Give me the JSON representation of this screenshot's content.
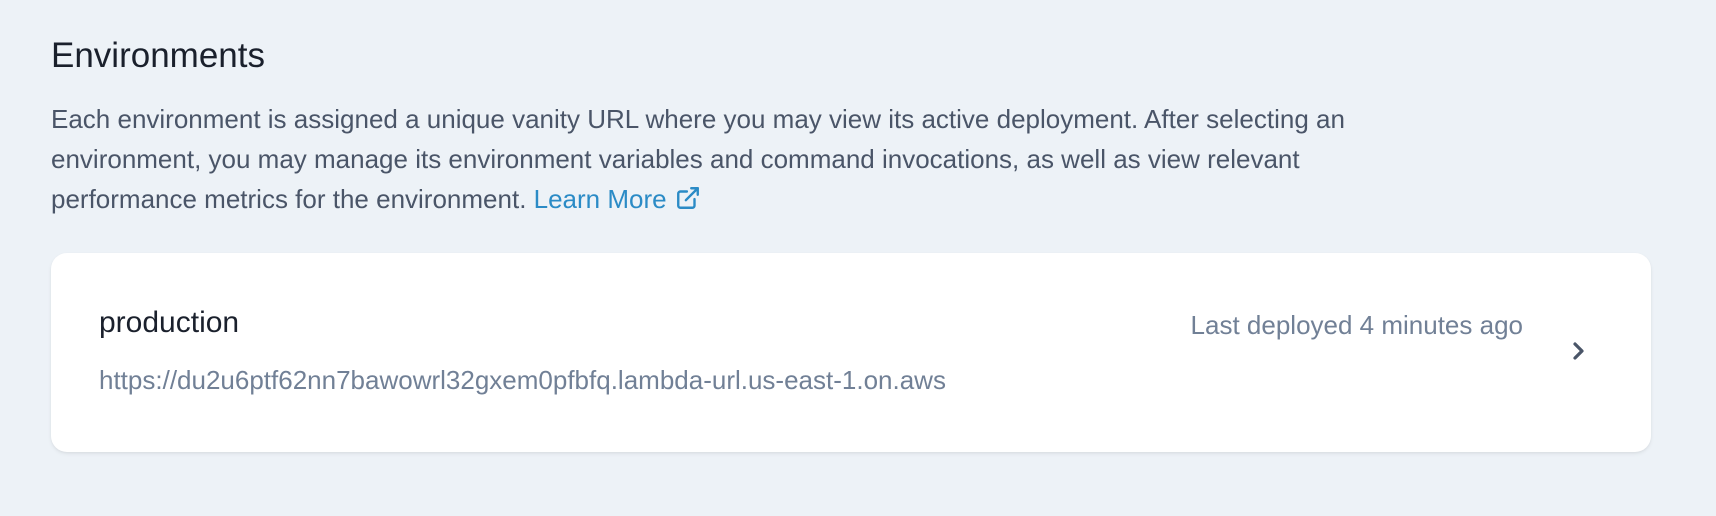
{
  "environments": {
    "title": "Environments",
    "description": "Each environment is assigned a unique vanity URL where you may view its active deployment. After selecting an environment, you may manage its environment variables and command invocations, as well as view relevant performance metrics for the environment. ",
    "learn_more": {
      "label": "Learn More",
      "icon": "external-link-icon"
    },
    "list": [
      {
        "name": "production",
        "url": "https://du2u6ptf62nn7bawowrl32gxem0pfbfq.lambda-url.us-east-1.on.aws",
        "last_deployed": "Last deployed 4 minutes ago",
        "icon": "chevron-right-icon"
      }
    ]
  },
  "colors": {
    "background": "#edf2f7",
    "card": "#ffffff",
    "heading": "#1a202c",
    "body_text": "#4a5568",
    "muted_text": "#718096",
    "link": "#2b8bc6",
    "chevron": "#4a5568"
  }
}
